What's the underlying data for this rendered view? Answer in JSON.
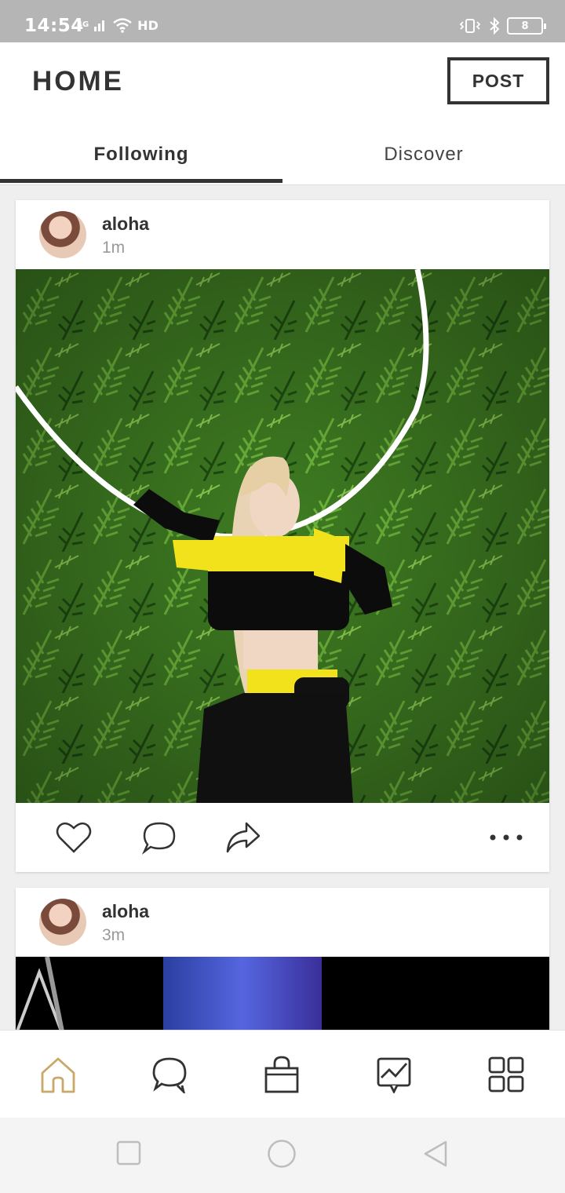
{
  "status_bar": {
    "time": "14:54",
    "network": "4G",
    "hd": "HD",
    "battery": "8"
  },
  "header": {
    "title": "HOME",
    "post_label": "POST"
  },
  "tabs": [
    {
      "label": "Following",
      "active": true
    },
    {
      "label": "Discover",
      "active": false
    }
  ],
  "posts": [
    {
      "username": "aloha",
      "time_ago": "1m"
    },
    {
      "username": "aloha",
      "time_ago": "3m"
    }
  ],
  "post_actions": [
    "heart-icon",
    "comment-icon",
    "share-icon",
    "more-icon"
  ],
  "bottom_nav": [
    {
      "icon": "home-icon",
      "active": true
    },
    {
      "icon": "chat-icon",
      "active": false
    },
    {
      "icon": "shop-bag-icon",
      "active": false
    },
    {
      "icon": "activity-icon",
      "active": false
    },
    {
      "icon": "grid-menu-icon",
      "active": false
    }
  ],
  "system_nav": [
    "recent-apps-icon",
    "home-circle-icon",
    "back-icon"
  ],
  "colors": {
    "active_nav": "#c9a86a",
    "text_dark": "#333333",
    "text_muted": "#999999",
    "status_bar": "#b5b5b5"
  }
}
